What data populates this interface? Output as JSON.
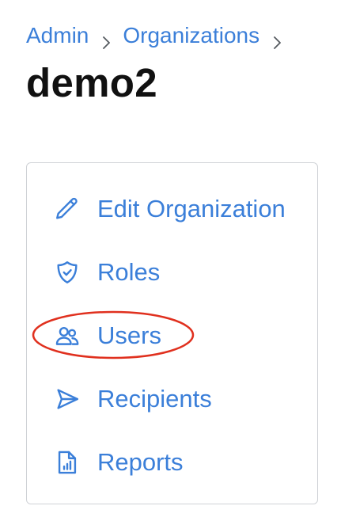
{
  "breadcrumb": {
    "items": [
      "Admin",
      "Organizations"
    ]
  },
  "page": {
    "title": "demo2"
  },
  "menu": {
    "items": [
      {
        "label": "Edit Organization",
        "icon": "pencil-icon"
      },
      {
        "label": "Roles",
        "icon": "shield-check-icon"
      },
      {
        "label": "Users",
        "icon": "users-icon"
      },
      {
        "label": "Recipients",
        "icon": "paper-plane-icon"
      },
      {
        "label": "Reports",
        "icon": "document-chart-icon"
      }
    ]
  },
  "colors": {
    "link": "#3b7fd9",
    "title": "#111111",
    "card_border": "#cfd2d6",
    "highlight": "#e0301e"
  }
}
